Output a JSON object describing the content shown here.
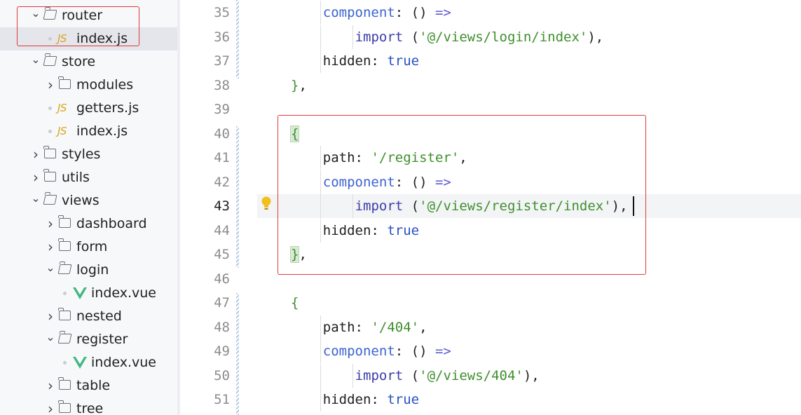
{
  "sidebar": {
    "items": [
      {
        "label": "router",
        "kind": "folder",
        "open": true,
        "level": 1,
        "icon": "folder-open-icon"
      },
      {
        "label": "index.js",
        "kind": "js",
        "level": 2,
        "selected": true,
        "icon": "js-file-icon",
        "badge": "JS"
      },
      {
        "label": "store",
        "kind": "folder",
        "open": true,
        "level": 1,
        "icon": "folder-open-icon"
      },
      {
        "label": "modules",
        "kind": "folder",
        "open": false,
        "level": 2,
        "icon": "folder-icon"
      },
      {
        "label": "getters.js",
        "kind": "js",
        "level": 2,
        "icon": "js-file-icon",
        "badge": "JS"
      },
      {
        "label": "index.js",
        "kind": "js",
        "level": 2,
        "icon": "js-file-icon",
        "badge": "JS"
      },
      {
        "label": "styles",
        "kind": "folder",
        "open": false,
        "level": 1,
        "icon": "folder-icon"
      },
      {
        "label": "utils",
        "kind": "folder",
        "open": false,
        "level": 1,
        "icon": "folder-icon"
      },
      {
        "label": "views",
        "kind": "folder",
        "open": true,
        "level": 1,
        "icon": "folder-open-icon"
      },
      {
        "label": "dashboard",
        "kind": "folder",
        "open": false,
        "level": 2,
        "icon": "folder-icon"
      },
      {
        "label": "form",
        "kind": "folder",
        "open": false,
        "level": 2,
        "icon": "folder-icon"
      },
      {
        "label": "login",
        "kind": "folder",
        "open": true,
        "level": 2,
        "icon": "folder-open-icon"
      },
      {
        "label": "index.vue",
        "kind": "vue",
        "level": 3,
        "icon": "vue-file-icon"
      },
      {
        "label": "nested",
        "kind": "folder",
        "open": false,
        "level": 2,
        "icon": "folder-icon"
      },
      {
        "label": "register",
        "kind": "folder",
        "open": true,
        "level": 2,
        "icon": "folder-open-icon"
      },
      {
        "label": "index.vue",
        "kind": "vue",
        "level": 3,
        "icon": "vue-file-icon"
      },
      {
        "label": "table",
        "kind": "folder",
        "open": false,
        "level": 2,
        "icon": "folder-icon"
      },
      {
        "label": "tree",
        "kind": "folder",
        "open": false,
        "level": 2,
        "icon": "folder-icon"
      }
    ]
  },
  "editor": {
    "current_line": 43,
    "lines": [
      {
        "num": "35",
        "indent": 1,
        "tokens": [
          [
            "k",
            "component"
          ],
          [
            "p",
            ": "
          ],
          [
            "p",
            "() "
          ],
          [
            "a",
            "=>"
          ]
        ]
      },
      {
        "num": "36",
        "indent": 2,
        "tokens": [
          [
            "i",
            "import"
          ],
          [
            "p",
            " ("
          ],
          [
            "s",
            "'@/views/login/index'"
          ],
          [
            "p",
            "),"
          ]
        ]
      },
      {
        "num": "37",
        "indent": 1,
        "tokens": [
          [
            "p",
            "hidden: "
          ],
          [
            "b",
            "true"
          ]
        ]
      },
      {
        "num": "38",
        "indent": 0,
        "tokens": [
          [
            "g",
            "}"
          ],
          [
            "p",
            ","
          ]
        ]
      },
      {
        "num": "39",
        "indent": 0,
        "tokens": []
      },
      {
        "num": "40",
        "indent": 0,
        "tokens": [
          [
            "gh",
            "{"
          ]
        ]
      },
      {
        "num": "41",
        "indent": 1,
        "tokens": [
          [
            "p",
            "path: "
          ],
          [
            "s",
            "'/register'"
          ],
          [
            "p",
            ","
          ]
        ]
      },
      {
        "num": "42",
        "indent": 1,
        "tokens": [
          [
            "k",
            "component"
          ],
          [
            "p",
            ": "
          ],
          [
            "p",
            "() "
          ],
          [
            "a",
            "=>"
          ]
        ]
      },
      {
        "num": "43",
        "indent": 2,
        "tokens": [
          [
            "i",
            "import"
          ],
          [
            "p",
            " ("
          ],
          [
            "s",
            "'@/views/register/index'"
          ],
          [
            "p",
            "),"
          ]
        ]
      },
      {
        "num": "44",
        "indent": 1,
        "tokens": [
          [
            "p",
            "hidden: "
          ],
          [
            "b",
            "true"
          ]
        ]
      },
      {
        "num": "45",
        "indent": 0,
        "tokens": [
          [
            "gh",
            "}"
          ],
          [
            "p",
            ","
          ]
        ]
      },
      {
        "num": "46",
        "indent": 0,
        "tokens": []
      },
      {
        "num": "47",
        "indent": 0,
        "tokens": [
          [
            "g",
            "{"
          ]
        ]
      },
      {
        "num": "48",
        "indent": 1,
        "tokens": [
          [
            "p",
            "path: "
          ],
          [
            "s",
            "'/404'"
          ],
          [
            "p",
            ","
          ]
        ]
      },
      {
        "num": "49",
        "indent": 1,
        "tokens": [
          [
            "k",
            "component"
          ],
          [
            "p",
            ": "
          ],
          [
            "p",
            "() "
          ],
          [
            "a",
            "=>"
          ]
        ]
      },
      {
        "num": "50",
        "indent": 2,
        "tokens": [
          [
            "i",
            "import"
          ],
          [
            "p",
            " ("
          ],
          [
            "s",
            "'@/views/404'"
          ],
          [
            "p",
            "),"
          ]
        ]
      },
      {
        "num": "51",
        "indent": 1,
        "tokens": [
          [
            "p",
            "hidden: "
          ],
          [
            "b",
            "true"
          ]
        ]
      }
    ]
  },
  "colors": {
    "highlight_border": "#e0393e",
    "keyword": "#3c63d0",
    "string": "#3f8f2e",
    "selected_row": "#e4e6eb",
    "bulb": "#f2c01e"
  }
}
